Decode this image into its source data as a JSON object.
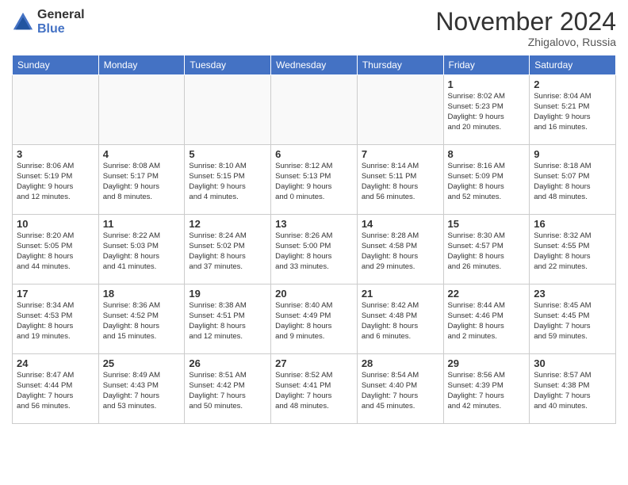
{
  "logo": {
    "general": "General",
    "blue": "Blue"
  },
  "header": {
    "title": "November 2024",
    "location": "Zhigalovo, Russia"
  },
  "weekdays": [
    "Sunday",
    "Monday",
    "Tuesday",
    "Wednesday",
    "Thursday",
    "Friday",
    "Saturday"
  ],
  "weeks": [
    [
      {
        "day": "",
        "info": ""
      },
      {
        "day": "",
        "info": ""
      },
      {
        "day": "",
        "info": ""
      },
      {
        "day": "",
        "info": ""
      },
      {
        "day": "",
        "info": ""
      },
      {
        "day": "1",
        "info": "Sunrise: 8:02 AM\nSunset: 5:23 PM\nDaylight: 9 hours\nand 20 minutes."
      },
      {
        "day": "2",
        "info": "Sunrise: 8:04 AM\nSunset: 5:21 PM\nDaylight: 9 hours\nand 16 minutes."
      }
    ],
    [
      {
        "day": "3",
        "info": "Sunrise: 8:06 AM\nSunset: 5:19 PM\nDaylight: 9 hours\nand 12 minutes."
      },
      {
        "day": "4",
        "info": "Sunrise: 8:08 AM\nSunset: 5:17 PM\nDaylight: 9 hours\nand 8 minutes."
      },
      {
        "day": "5",
        "info": "Sunrise: 8:10 AM\nSunset: 5:15 PM\nDaylight: 9 hours\nand 4 minutes."
      },
      {
        "day": "6",
        "info": "Sunrise: 8:12 AM\nSunset: 5:13 PM\nDaylight: 9 hours\nand 0 minutes."
      },
      {
        "day": "7",
        "info": "Sunrise: 8:14 AM\nSunset: 5:11 PM\nDaylight: 8 hours\nand 56 minutes."
      },
      {
        "day": "8",
        "info": "Sunrise: 8:16 AM\nSunset: 5:09 PM\nDaylight: 8 hours\nand 52 minutes."
      },
      {
        "day": "9",
        "info": "Sunrise: 8:18 AM\nSunset: 5:07 PM\nDaylight: 8 hours\nand 48 minutes."
      }
    ],
    [
      {
        "day": "10",
        "info": "Sunrise: 8:20 AM\nSunset: 5:05 PM\nDaylight: 8 hours\nand 44 minutes."
      },
      {
        "day": "11",
        "info": "Sunrise: 8:22 AM\nSunset: 5:03 PM\nDaylight: 8 hours\nand 41 minutes."
      },
      {
        "day": "12",
        "info": "Sunrise: 8:24 AM\nSunset: 5:02 PM\nDaylight: 8 hours\nand 37 minutes."
      },
      {
        "day": "13",
        "info": "Sunrise: 8:26 AM\nSunset: 5:00 PM\nDaylight: 8 hours\nand 33 minutes."
      },
      {
        "day": "14",
        "info": "Sunrise: 8:28 AM\nSunset: 4:58 PM\nDaylight: 8 hours\nand 29 minutes."
      },
      {
        "day": "15",
        "info": "Sunrise: 8:30 AM\nSunset: 4:57 PM\nDaylight: 8 hours\nand 26 minutes."
      },
      {
        "day": "16",
        "info": "Sunrise: 8:32 AM\nSunset: 4:55 PM\nDaylight: 8 hours\nand 22 minutes."
      }
    ],
    [
      {
        "day": "17",
        "info": "Sunrise: 8:34 AM\nSunset: 4:53 PM\nDaylight: 8 hours\nand 19 minutes."
      },
      {
        "day": "18",
        "info": "Sunrise: 8:36 AM\nSunset: 4:52 PM\nDaylight: 8 hours\nand 15 minutes."
      },
      {
        "day": "19",
        "info": "Sunrise: 8:38 AM\nSunset: 4:51 PM\nDaylight: 8 hours\nand 12 minutes."
      },
      {
        "day": "20",
        "info": "Sunrise: 8:40 AM\nSunset: 4:49 PM\nDaylight: 8 hours\nand 9 minutes."
      },
      {
        "day": "21",
        "info": "Sunrise: 8:42 AM\nSunset: 4:48 PM\nDaylight: 8 hours\nand 6 minutes."
      },
      {
        "day": "22",
        "info": "Sunrise: 8:44 AM\nSunset: 4:46 PM\nDaylight: 8 hours\nand 2 minutes."
      },
      {
        "day": "23",
        "info": "Sunrise: 8:45 AM\nSunset: 4:45 PM\nDaylight: 7 hours\nand 59 minutes."
      }
    ],
    [
      {
        "day": "24",
        "info": "Sunrise: 8:47 AM\nSunset: 4:44 PM\nDaylight: 7 hours\nand 56 minutes."
      },
      {
        "day": "25",
        "info": "Sunrise: 8:49 AM\nSunset: 4:43 PM\nDaylight: 7 hours\nand 53 minutes."
      },
      {
        "day": "26",
        "info": "Sunrise: 8:51 AM\nSunset: 4:42 PM\nDaylight: 7 hours\nand 50 minutes."
      },
      {
        "day": "27",
        "info": "Sunrise: 8:52 AM\nSunset: 4:41 PM\nDaylight: 7 hours\nand 48 minutes."
      },
      {
        "day": "28",
        "info": "Sunrise: 8:54 AM\nSunset: 4:40 PM\nDaylight: 7 hours\nand 45 minutes."
      },
      {
        "day": "29",
        "info": "Sunrise: 8:56 AM\nSunset: 4:39 PM\nDaylight: 7 hours\nand 42 minutes."
      },
      {
        "day": "30",
        "info": "Sunrise: 8:57 AM\nSunset: 4:38 PM\nDaylight: 7 hours\nand 40 minutes."
      }
    ]
  ]
}
